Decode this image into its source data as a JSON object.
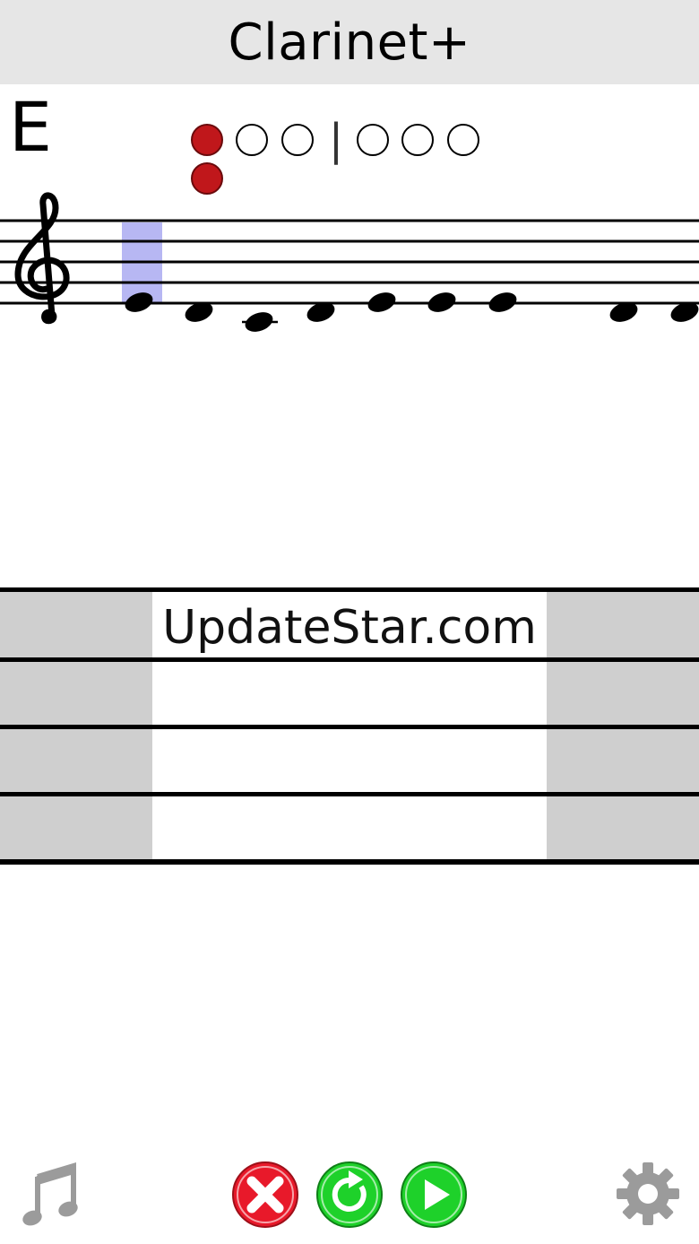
{
  "header": {
    "title": "Clarinet+"
  },
  "note": {
    "letter": "E"
  },
  "fingering": {
    "separator": "|",
    "holes_left_filled": [
      true,
      false,
      false
    ],
    "holes_right_filled": [
      false,
      false,
      false
    ],
    "extra_key_filled": true,
    "filled_color": "#c0171b",
    "highlight_color": "#b7b7f3"
  },
  "staff": {
    "clef-icon": "treble-clef-icon",
    "selected_index": 0
  },
  "ad": {
    "text": "UpdateStar.com"
  },
  "toolbar": {
    "music_icon": "music-note-icon",
    "cancel_icon": "red-x-icon",
    "reset_icon": "refresh-icon",
    "play_icon": "play-icon",
    "settings_icon": "gear-icon",
    "cancel_color": "#e8192a",
    "ok_color": "#1ed12a"
  }
}
